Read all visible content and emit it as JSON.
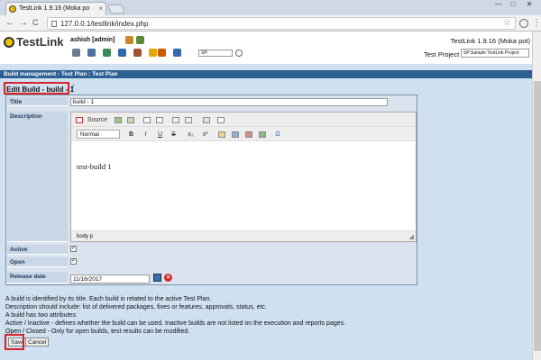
{
  "browser": {
    "tab_title": "TestLink 1.9.16 (Moka po",
    "tab_close": "×",
    "url": "127.0.0.1/testlink/index.php",
    "back": "←",
    "forward": "→",
    "reload": "C",
    "star": "☆",
    "menu": "⋮",
    "window_min": "—",
    "window_max": "□",
    "window_close": "✕"
  },
  "header": {
    "logo": "TestLink",
    "user": "ashish [admin]",
    "version": "TestLink 1.9.16 (Moka pot)",
    "test_project_label": "Test Project",
    "test_project_value": "SP:Sample TestLink Project",
    "search_value": "SP-"
  },
  "breadcrumb": "Build management - Test Plan : Test Plan",
  "page": {
    "title": "Edit Build - build - 1",
    "help": "i"
  },
  "form": {
    "title_label": "Title",
    "title_value": "build - 1",
    "description_label": "Description",
    "active_label": "Active",
    "active_checked": "✓",
    "open_label": "Open",
    "open_checked": "✓",
    "release_label": "Release date",
    "release_value": "11/16/2017",
    "clear": "×"
  },
  "editor": {
    "source": "Source",
    "format": "Normal",
    "bold": "B",
    "italic": "I",
    "underline": "U",
    "strike": "S",
    "subscript": "x₂",
    "superscript": "x²",
    "omega": "Ω",
    "content": "test-build 1",
    "footer_path": "body   p",
    "resize": "◢"
  },
  "info_lines": [
    "A build is identified by its title. Each build is related to the active Test Plan.",
    "Description should include: list of delivered packages, fixes or features, approvals, status, etc.",
    "A build has two attributes:",
    "Active / Inactive - defines whether the build can be used. Inactive builds are not listed on the execution and reports pages.",
    "Open / Closed - Only for open builds, test results can be modified."
  ],
  "buttons": {
    "save": "Save",
    "cancel": "Cancel"
  }
}
